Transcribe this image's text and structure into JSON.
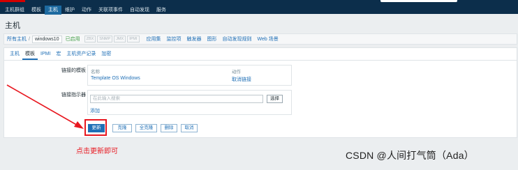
{
  "topnav": {
    "items": [
      "主机群组",
      "模板",
      "主机",
      "维护",
      "动作",
      "关联项事件",
      "自动发现",
      "服务"
    ],
    "active_index": 2
  },
  "page": {
    "title": "主机"
  },
  "hostbar": {
    "all_hosts": "所有主机",
    "separator": "/",
    "current_host": "windows10",
    "status": "已启用",
    "availability": [
      "ZBX",
      "SNMP",
      "JMX",
      "IPMI"
    ],
    "links": [
      "应用集",
      "监控项",
      "触发器",
      "图形",
      "自动发现规则",
      "Web 场景"
    ]
  },
  "tabs": {
    "items": [
      "主机",
      "模板",
      "IPMI",
      "宏",
      "主机资产记录",
      "加密"
    ],
    "active_index": 1
  },
  "linked_templates": {
    "label": "链接的模板",
    "col_name": "名称",
    "col_action": "动作",
    "rows": [
      {
        "name": "Template OS Windows",
        "action": "取消链接"
      }
    ]
  },
  "link_indicator": {
    "label": "链接指示器",
    "placeholder": "在此输入搜索",
    "select_label": "选择",
    "add_label": "添加"
  },
  "actions": {
    "update": "更新",
    "clone": "克隆",
    "full_clone": "全克隆",
    "delete": "删除",
    "cancel": "取消"
  },
  "annotation": {
    "text": "点击更新即可"
  },
  "watermark": {
    "text": "CSDN @人间打气筒（Ada）"
  },
  "colors": {
    "nav_bg": "#0c2e4b",
    "nav_active": "#1d6aa0",
    "link": "#1f6fb6",
    "enabled": "#429e47",
    "annotation_red": "#e8171f"
  }
}
